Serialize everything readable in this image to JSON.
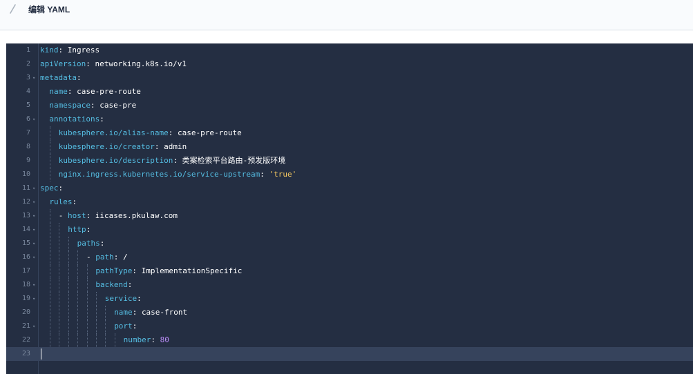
{
  "header": {
    "title": "编辑 YAML",
    "icon": "pencil-icon"
  },
  "editor": {
    "active_line": 23,
    "lines": [
      {
        "n": "1",
        "fold": "",
        "indent": 0,
        "dash": "",
        "key": "kind",
        "sep": ": ",
        "val": "Ingress",
        "vtype": "v"
      },
      {
        "n": "2",
        "fold": "",
        "indent": 0,
        "dash": "",
        "key": "apiVersion",
        "sep": ": ",
        "val": "networking.k8s.io/v1",
        "vtype": "v"
      },
      {
        "n": "3",
        "fold": "▾",
        "indent": 0,
        "dash": "",
        "key": "metadata",
        "sep": ":",
        "val": "",
        "vtype": "v"
      },
      {
        "n": "4",
        "fold": "",
        "indent": 1,
        "dash": "",
        "key": "name",
        "sep": ": ",
        "val": "case-pre-route",
        "vtype": "v"
      },
      {
        "n": "5",
        "fold": "",
        "indent": 1,
        "dash": "",
        "key": "namespace",
        "sep": ": ",
        "val": "case-pre",
        "vtype": "v"
      },
      {
        "n": "6",
        "fold": "▾",
        "indent": 1,
        "dash": "",
        "key": "annotations",
        "sep": ":",
        "val": "",
        "vtype": "v"
      },
      {
        "n": "7",
        "fold": "",
        "indent": 2,
        "dash": "",
        "key": "kubesphere.io/alias-name",
        "sep": ": ",
        "val": "case-pre-route",
        "vtype": "v"
      },
      {
        "n": "8",
        "fold": "",
        "indent": 2,
        "dash": "",
        "key": "kubesphere.io/creator",
        "sep": ": ",
        "val": "admin",
        "vtype": "v"
      },
      {
        "n": "9",
        "fold": "",
        "indent": 2,
        "dash": "",
        "key": "kubesphere.io/description",
        "sep": ": ",
        "val": "类案检索平台路由-预发版环境",
        "vtype": "v"
      },
      {
        "n": "10",
        "fold": "",
        "indent": 2,
        "dash": "",
        "key": "nginx.ingress.kubernetes.io/service-upstream",
        "sep": ": ",
        "val": "'true'",
        "vtype": "s"
      },
      {
        "n": "11",
        "fold": "▾",
        "indent": 0,
        "dash": "",
        "key": "spec",
        "sep": ":",
        "val": "",
        "vtype": "v"
      },
      {
        "n": "12",
        "fold": "▾",
        "indent": 1,
        "dash": "",
        "key": "rules",
        "sep": ":",
        "val": "",
        "vtype": "v"
      },
      {
        "n": "13",
        "fold": "▾",
        "indent": 2,
        "dash": "- ",
        "key": "host",
        "sep": ": ",
        "val": "iicases.pkulaw.com",
        "vtype": "v"
      },
      {
        "n": "14",
        "fold": "▾",
        "indent": 3,
        "dash": "",
        "key": "http",
        "sep": ":",
        "val": "",
        "vtype": "v"
      },
      {
        "n": "15",
        "fold": "▾",
        "indent": 4,
        "dash": "",
        "key": "paths",
        "sep": ":",
        "val": "",
        "vtype": "v"
      },
      {
        "n": "16",
        "fold": "▾",
        "indent": 5,
        "dash": "- ",
        "key": "path",
        "sep": ": ",
        "val": "/",
        "vtype": "v"
      },
      {
        "n": "17",
        "fold": "",
        "indent": 6,
        "dash": "",
        "key": "pathType",
        "sep": ": ",
        "val": "ImplementationSpecific",
        "vtype": "v"
      },
      {
        "n": "18",
        "fold": "▾",
        "indent": 6,
        "dash": "",
        "key": "backend",
        "sep": ":",
        "val": "",
        "vtype": "v"
      },
      {
        "n": "19",
        "fold": "▾",
        "indent": 7,
        "dash": "",
        "key": "service",
        "sep": ":",
        "val": "",
        "vtype": "v"
      },
      {
        "n": "20",
        "fold": "",
        "indent": 8,
        "dash": "",
        "key": "name",
        "sep": ": ",
        "val": "case-front",
        "vtype": "v"
      },
      {
        "n": "21",
        "fold": "▾",
        "indent": 8,
        "dash": "",
        "key": "port",
        "sep": ":",
        "val": "",
        "vtype": "v"
      },
      {
        "n": "22",
        "fold": "",
        "indent": 9,
        "dash": "",
        "key": "number",
        "sep": ": ",
        "val": "80",
        "vtype": "n"
      },
      {
        "n": "23",
        "fold": "",
        "indent": 0,
        "dash": "",
        "key": "",
        "sep": "",
        "val": "",
        "vtype": "v"
      }
    ]
  },
  "colors": {
    "editor_bg": "#242e42",
    "key": "#55bde2",
    "string": "#f5c860",
    "number": "#b88cf5",
    "line_number": "#79879c"
  }
}
